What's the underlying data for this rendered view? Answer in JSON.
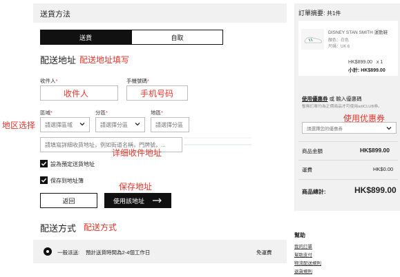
{
  "shipping": {
    "title": "送貨方法",
    "tab_delivery": "送貨",
    "tab_pickup": "自取",
    "address_heading": "配送地址",
    "address_annotation": "配送地址填写",
    "recipient_label": "收件人",
    "recipient_annotation": "收件人",
    "phone_label": "手機號碼",
    "phone_annotation": "手机号码",
    "region_label": "區域",
    "region_placeholder": "請選擇區域",
    "district_label": "分區",
    "district_placeholder": "請選擇分區",
    "area_label": "地區",
    "area_placeholder": "請選擇分區",
    "region_annotation": "地区选择",
    "detail_placeholder": "請填寫詳細收貨地址，例如街道名稱，門牌號，...",
    "detail_annotation": "详细收件地址",
    "default_checkbox_label": "設為預定送貨地址",
    "save_checkbox_label": "保存到地址簿",
    "save_annotation": "保存地址",
    "back_button": "返回",
    "use_address_button": "使用該地址",
    "method_heading": "配送方式",
    "method_annotation": "配送方式",
    "method_option": "一般派送:",
    "method_desc": "預計送貨時間為2-4個工作日",
    "method_price": "免運費"
  },
  "summary": {
    "title": "訂單摘要:",
    "count": "共1件",
    "product_name": "DISNEY STAN SMITH 運動鞋",
    "product_color": "顏色：白色",
    "product_size": "尺碼：UK 6",
    "product_price_qty": "HK$899.00   x 1",
    "subtotal_label": "小計:",
    "subtotal_value": "HK$899.00",
    "coupon_tab": "使用優惠券",
    "coupon_or": "或",
    "coupon_code_tab": "輸入優惠碼",
    "coupon_note": "暫無訂單均為正價商品才可使用adiCLUB券。",
    "coupon_annotation": "使用优惠券",
    "coupon_placeholder": "請選擇您的優惠券",
    "goods_amount_label": "商品金額",
    "goods_amount_value": "HK$899.00",
    "shipping_label": "運費",
    "shipping_value": "HK$0.00",
    "total_label": "商品總計:",
    "total_value": "HK$899.00"
  },
  "help": {
    "title": "幫助",
    "links": [
      "我的訂單",
      "幫助支付",
      "物流配送規則",
      "退貨規則"
    ]
  },
  "colors": {
    "annotation_red": "#e8372e",
    "panel_grey": "#f1f1f1",
    "button_black": "#111111"
  }
}
